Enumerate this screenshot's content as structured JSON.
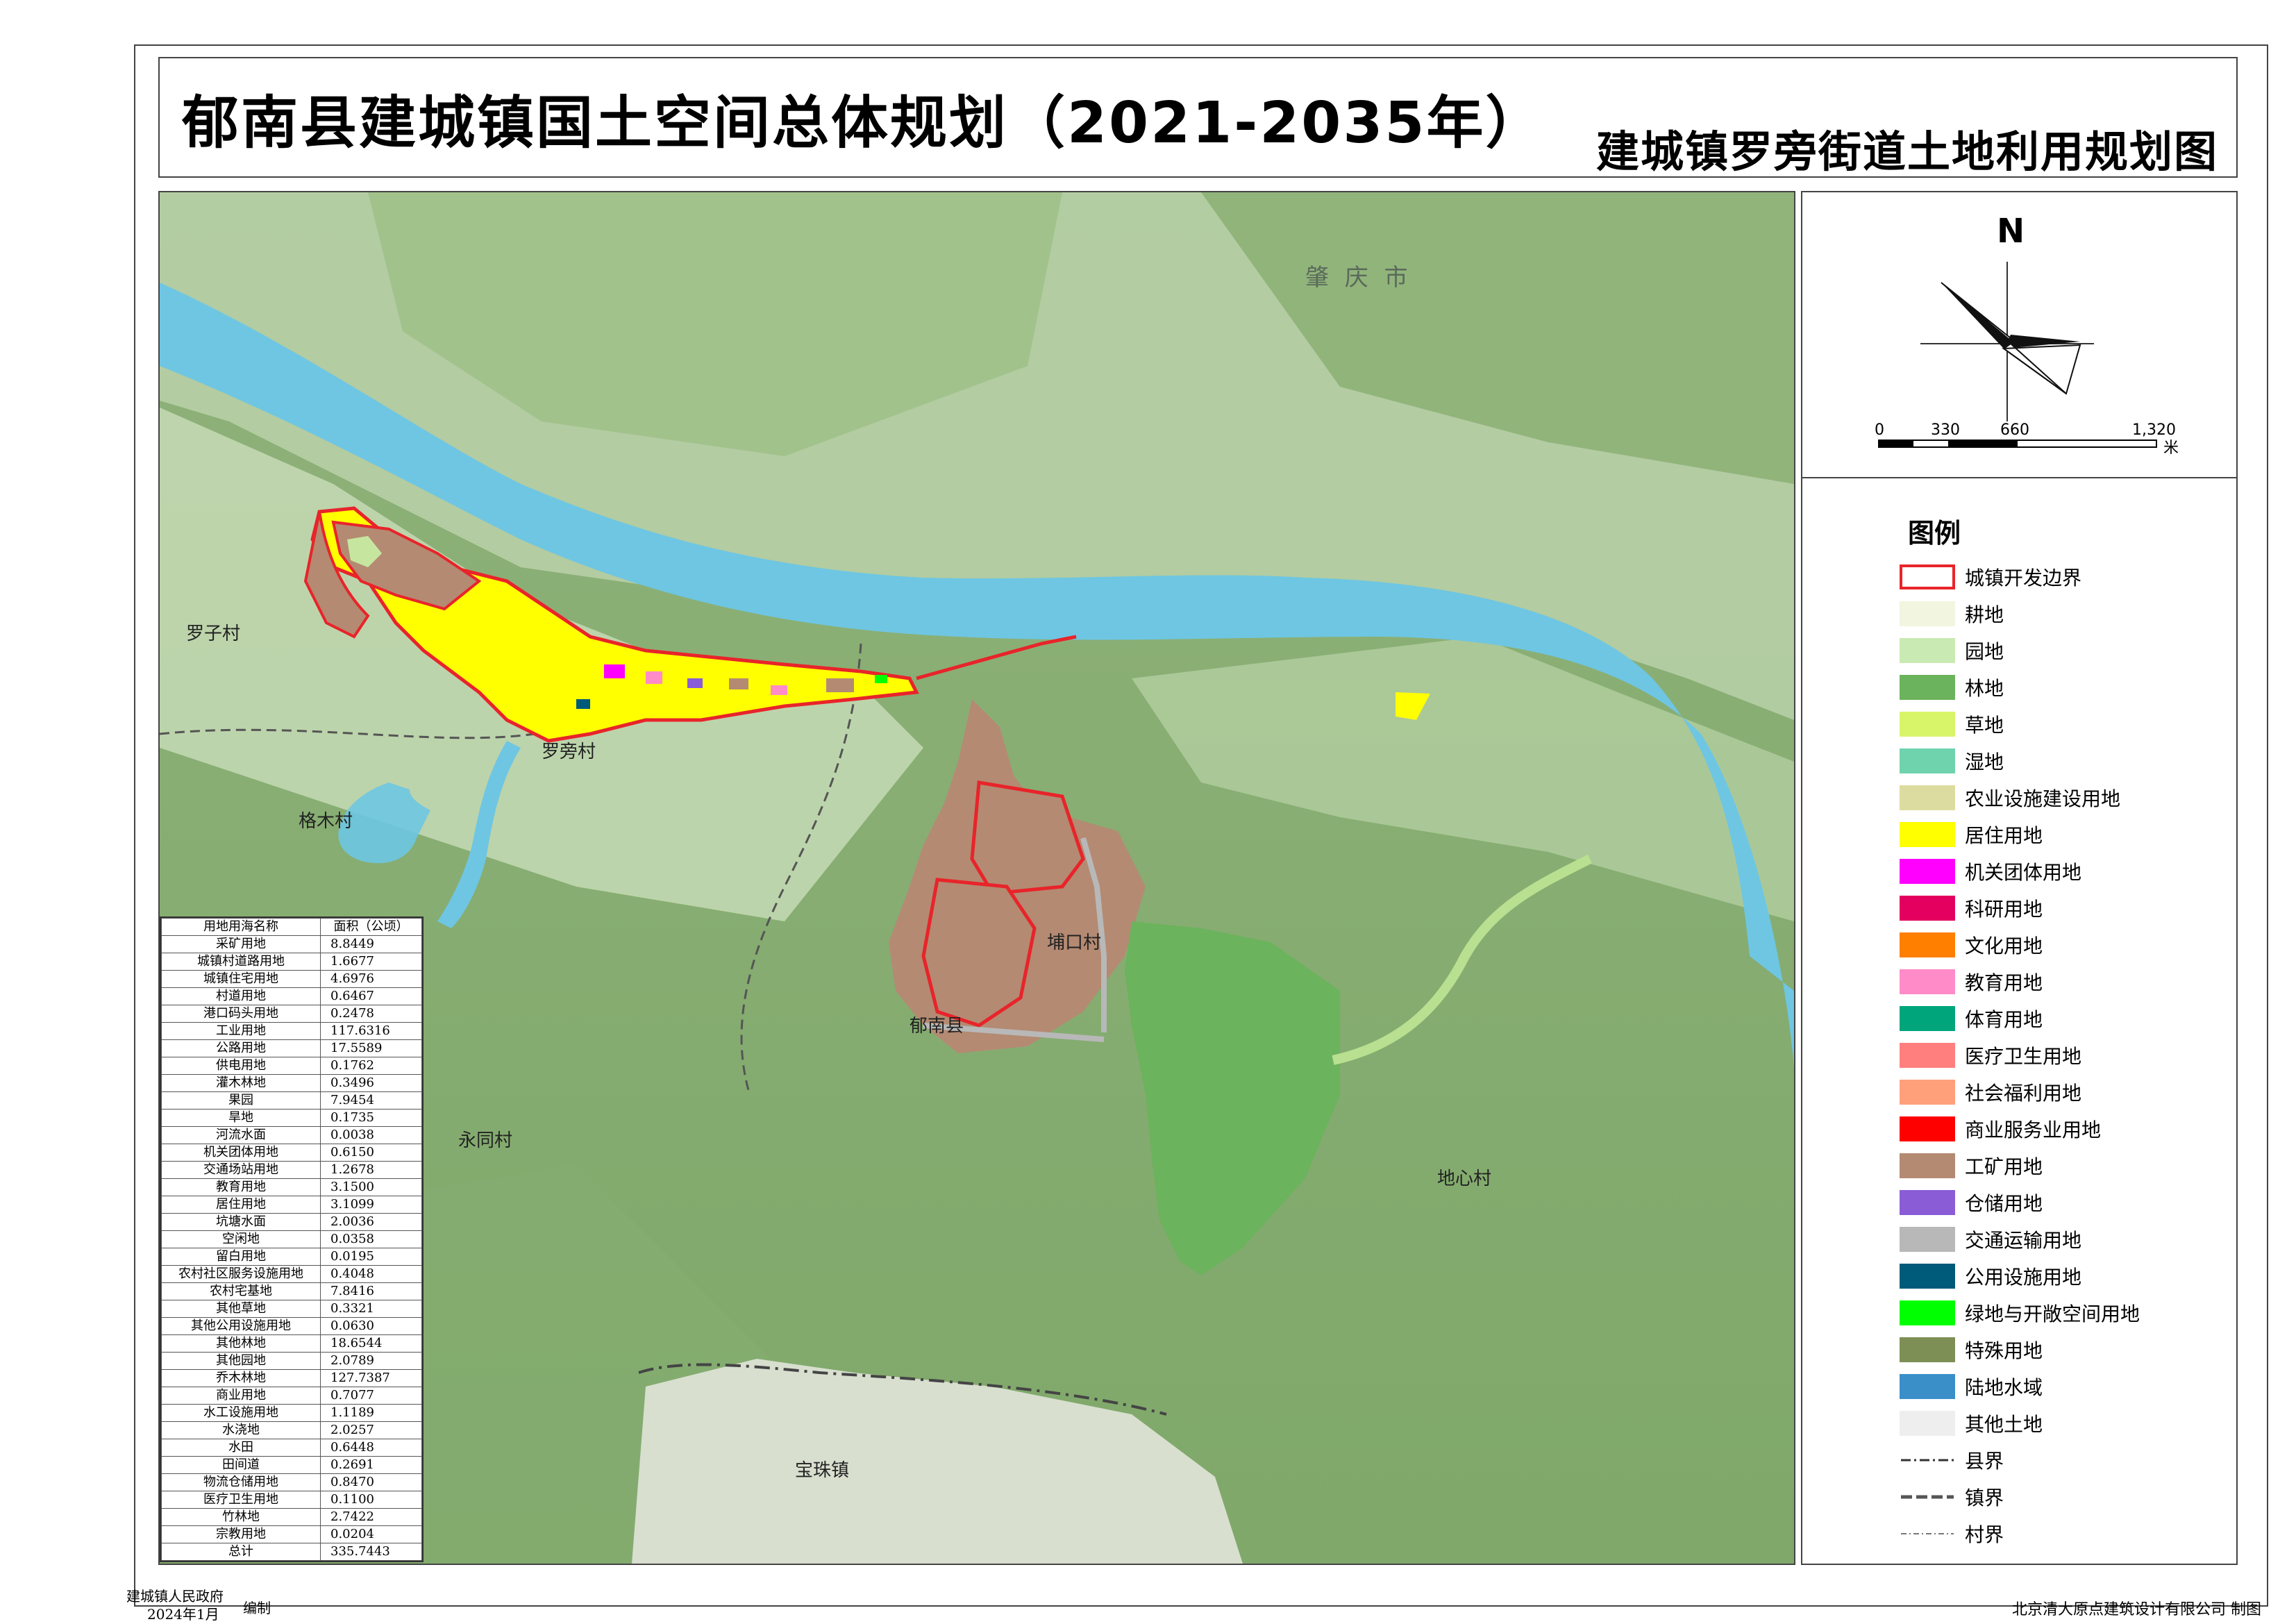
{
  "header": {
    "main_title": "郁南县建城镇国土空间总体规划（2021-2035年）",
    "sub_title": "建城镇罗旁街道土地利用规划图"
  },
  "map": {
    "labels": {
      "zhaoqing": "肇 庆 市",
      "luozi": "罗子村",
      "gemu": "格木村",
      "luopang": "罗旁村",
      "bukou": "埔口村",
      "yunan": "郁南县",
      "yongtong": "永同村",
      "dixin": "地心村",
      "baozhu": "宝珠镇"
    },
    "colors": {
      "river": "#6ec6e2",
      "dev_boundary": "#e8242a",
      "industrial": "#b48a72",
      "forest": "#6bb35c",
      "residential": "#ffff00",
      "institution": "#ff00ff",
      "education": "#ff8bc8",
      "transport": "#b8b8b8"
    }
  },
  "compass": {
    "north": "N",
    "scale_ticks": [
      "0",
      "330",
      "660",
      "1,320"
    ],
    "scale_unit": "米"
  },
  "legend": {
    "title": "图例",
    "items": [
      {
        "label": "城镇开发边界",
        "color": "#ffffff",
        "border": "#e8242a",
        "kind": "box"
      },
      {
        "label": "耕地",
        "color": "#f2f5df",
        "kind": "fill"
      },
      {
        "label": "园地",
        "color": "#c9eab2",
        "kind": "fill"
      },
      {
        "label": "林地",
        "color": "#6bb35c",
        "kind": "fill"
      },
      {
        "label": "草地",
        "color": "#d8f56a",
        "kind": "fill"
      },
      {
        "label": "湿地",
        "color": "#6fd3ad",
        "kind": "fill"
      },
      {
        "label": "农业设施建设用地",
        "color": "#dcdca0",
        "kind": "fill"
      },
      {
        "label": "居住用地",
        "color": "#ffff00",
        "kind": "fill"
      },
      {
        "label": "机关团体用地",
        "color": "#ff00ff",
        "kind": "fill"
      },
      {
        "label": "科研用地",
        "color": "#e3005f",
        "kind": "fill"
      },
      {
        "label": "文化用地",
        "color": "#ff7f00",
        "kind": "fill"
      },
      {
        "label": "教育用地",
        "color": "#ff8bc8",
        "kind": "fill"
      },
      {
        "label": "体育用地",
        "color": "#00a57b",
        "kind": "fill"
      },
      {
        "label": "医疗卫生用地",
        "color": "#ff7f7f",
        "kind": "fill"
      },
      {
        "label": "社会福利用地",
        "color": "#ffa07a",
        "kind": "fill"
      },
      {
        "label": "商业服务业用地",
        "color": "#ff0000",
        "kind": "fill"
      },
      {
        "label": "工矿用地",
        "color": "#b48a72",
        "kind": "fill"
      },
      {
        "label": "仓储用地",
        "color": "#8a5cd6",
        "kind": "fill"
      },
      {
        "label": "交通运输用地",
        "color": "#b8b8b8",
        "kind": "fill"
      },
      {
        "label": "公用设施用地",
        "color": "#005a7a",
        "kind": "fill"
      },
      {
        "label": "绿地与开敞空间用地",
        "color": "#00ff00",
        "kind": "fill"
      },
      {
        "label": "特殊用地",
        "color": "#7e8f55",
        "kind": "fill"
      },
      {
        "label": "陆地水域",
        "color": "#3a8fc8",
        "kind": "fill"
      },
      {
        "label": "其他土地",
        "color": "#eeeeee",
        "kind": "fill"
      },
      {
        "label": "县界",
        "color": "#333333",
        "kind": "line-county"
      },
      {
        "label": "镇界",
        "color": "#555555",
        "kind": "line-town"
      },
      {
        "label": "村界",
        "color": "#777777",
        "kind": "line-village"
      }
    ]
  },
  "area_table": {
    "headers": [
      "用地用海名称",
      "面积（公顷）"
    ],
    "rows": [
      [
        "采矿用地",
        "8.8449"
      ],
      [
        "城镇村道路用地",
        "1.6677"
      ],
      [
        "城镇住宅用地",
        "4.6976"
      ],
      [
        "村道用地",
        "0.6467"
      ],
      [
        "港口码头用地",
        "0.2478"
      ],
      [
        "工业用地",
        "117.6316"
      ],
      [
        "公路用地",
        "17.5589"
      ],
      [
        "供电用地",
        "0.1762"
      ],
      [
        "灌木林地",
        "0.3496"
      ],
      [
        "果园",
        "7.9454"
      ],
      [
        "旱地",
        "0.1735"
      ],
      [
        "河流水面",
        "0.0038"
      ],
      [
        "机关团体用地",
        "0.6150"
      ],
      [
        "交通场站用地",
        "1.2678"
      ],
      [
        "教育用地",
        "3.1500"
      ],
      [
        "居住用地",
        "3.1099"
      ],
      [
        "坑塘水面",
        "2.0036"
      ],
      [
        "空闲地",
        "0.0358"
      ],
      [
        "留白用地",
        "0.0195"
      ],
      [
        "农村社区服务设施用地",
        "0.4048"
      ],
      [
        "农村宅基地",
        "7.8416"
      ],
      [
        "其他草地",
        "0.3321"
      ],
      [
        "其他公用设施用地",
        "0.0630"
      ],
      [
        "其他林地",
        "18.6544"
      ],
      [
        "其他园地",
        "2.0789"
      ],
      [
        "乔木林地",
        "127.7387"
      ],
      [
        "商业用地",
        "0.7077"
      ],
      [
        "水工设施用地",
        "1.1189"
      ],
      [
        "水浇地",
        "2.0257"
      ],
      [
        "水田",
        "0.6448"
      ],
      [
        "田间道",
        "0.2691"
      ],
      [
        "物流仓储用地",
        "0.8470"
      ],
      [
        "医疗卫生用地",
        "0.1100"
      ],
      [
        "竹林地",
        "2.7422"
      ],
      [
        "宗教用地",
        "0.0204"
      ],
      [
        "总计",
        "335.7443"
      ]
    ]
  },
  "footer": {
    "left_org": "建城镇人民政府",
    "left_date": "2024年1月",
    "left_action": "编制",
    "right": "北京清大原点建筑设计有限公司  制图"
  }
}
